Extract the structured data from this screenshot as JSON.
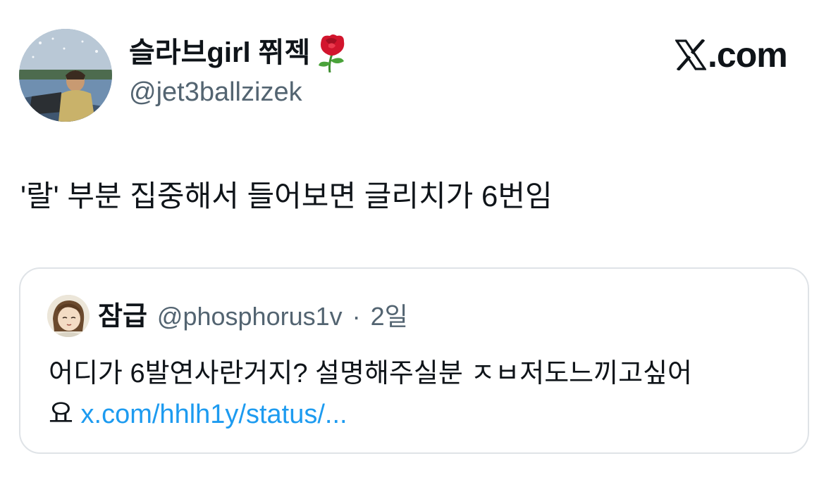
{
  "author": {
    "display_name": "슬라브girl 쮜젝",
    "name_emoji": "rose-icon",
    "handle": "@jet3ballzizek",
    "avatar": "profile-photo-man-on-boat"
  },
  "brand": {
    "logo": "x-logo-icon",
    "text": ".com"
  },
  "tweet": {
    "text": "'랄' 부분 집중해서 들어보면 글리치가 6번임"
  },
  "quote": {
    "name": "잠급",
    "handle": "@phosphorus1v",
    "separator": "·",
    "time": "2일",
    "avatar": "cartoon-avatar",
    "text_line1": "어디가 6발연사란거지? 설명해주실분 ㅈㅂ저도느끼고싶어",
    "text_line2": "요",
    "link": "x.com/hhlh1y/status/..."
  },
  "colors": {
    "text_primary": "#0f1419",
    "text_secondary": "#536471",
    "link": "#1d9bf0",
    "border": "#dfe3e7"
  }
}
